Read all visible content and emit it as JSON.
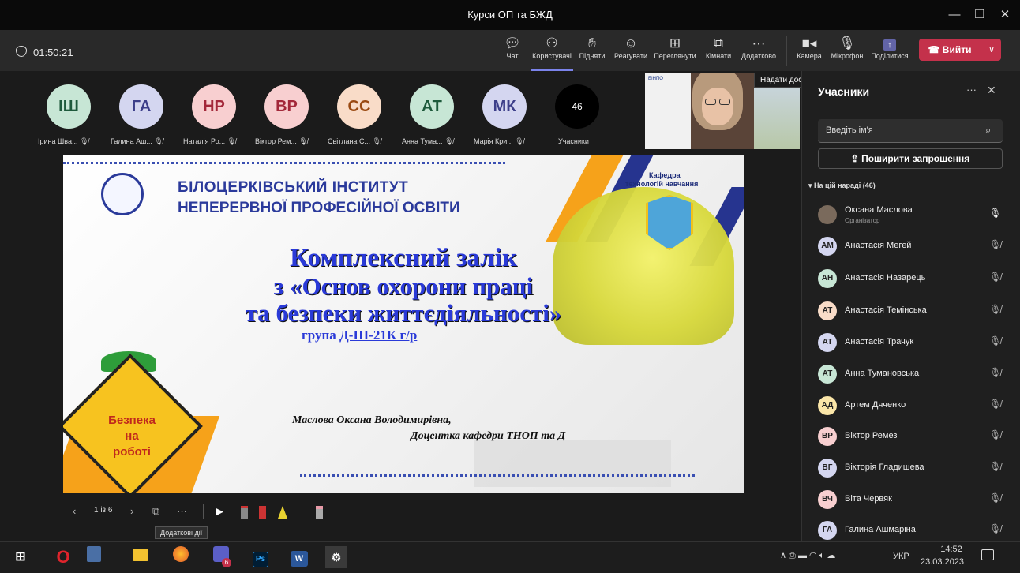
{
  "window": {
    "title": "Курси ОП та БЖД"
  },
  "meeting": {
    "timer": "01:50:21"
  },
  "toolbar": {
    "chat": "Чат",
    "people": "Користувачі",
    "raise": "Підняти",
    "react": "Реагувати",
    "view": "Переглянути",
    "rooms": "Кімнати",
    "more": "Додатково",
    "camera": "Камера",
    "mic": "Мікрофон",
    "share": "Поділитися",
    "leave": "Вийти"
  },
  "share_tooltip": "Надати доступ до вмісту (Ctrl+Shift+E)",
  "gallery": {
    "avatars": [
      {
        "initials": "ІШ",
        "name": "Ірина Шва...",
        "color": "#c7e6d5"
      },
      {
        "initials": "ГА",
        "name": "Галина Аш...",
        "color": "#d4d6f0"
      },
      {
        "initials": "НР",
        "name": "Наталія Ро...",
        "color": "#f8cfd0"
      },
      {
        "initials": "ВР",
        "name": "Віктор Рем...",
        "color": "#f8cfd0"
      },
      {
        "initials": "СС",
        "name": "Світлана С...",
        "color": "#f9dcc8"
      },
      {
        "initials": "АТ",
        "name": "Анна Тума...",
        "color": "#c7e6d5"
      },
      {
        "initials": "МК",
        "name": "Марія Кри...",
        "color": "#d4d6f0"
      }
    ],
    "count": "46",
    "count_label": "Учасники"
  },
  "slide": {
    "institute_line1": "БІЛОЦЕРКІВСЬКИЙ ІНСТИТУТ",
    "institute_line2": "НЕПЕРЕРВНОЇ ПРОФЕСІЙНОЇ ОСВІТИ",
    "dept_line1": "Кафедра",
    "dept_line2": "технологій навчання",
    "heading1": "Комплексний залік",
    "heading2": "з «Основ охорони праці",
    "heading3": "та безпеки життєдіяльності»",
    "group_prefix": "група",
    "group_value": "Д-ІІІ-21К г/р",
    "author": "Маслова Оксана Володимирівна,",
    "position": "Доцентка кафедри ТНОП та Д",
    "sign_line1": "Безпека",
    "sign_line2": "на",
    "sign_line3": "роботі"
  },
  "presenter_tile": {
    "badge": "БІНПО"
  },
  "slidebar": {
    "page": "1 із 6",
    "more_tooltip": "Додаткові дії"
  },
  "panel": {
    "title": "Учасники",
    "search_placeholder": "Введіть ім'я",
    "invite": "Поширити запрошення",
    "section": "На цій нараді (46)",
    "organizer_name": "Оксана Маслова",
    "organizer_role": "Організатор",
    "people": [
      {
        "initials": "АМ",
        "name": "Анастасія Мегей",
        "color": "#d4d6f0"
      },
      {
        "initials": "АН",
        "name": "Анастасія Назарець",
        "color": "#c7e6d5"
      },
      {
        "initials": "АТ",
        "name": "Анастасія Темінська",
        "color": "#f9dcc8"
      },
      {
        "initials": "АТ",
        "name": "Анастасія Трачук",
        "color": "#d4d6f0"
      },
      {
        "initials": "АТ",
        "name": "Анна Тумановська",
        "color": "#c7e6d5"
      },
      {
        "initials": "АД",
        "name": "Артем Дяченко",
        "color": "#fbe6a8"
      },
      {
        "initials": "ВР",
        "name": "Віктор Ремез",
        "color": "#f8cfd0"
      },
      {
        "initials": "ВГ",
        "name": "Вікторія Гладишева",
        "color": "#d4d6f0"
      },
      {
        "initials": "ВЧ",
        "name": "Віта Червяк",
        "color": "#f8cfd0"
      },
      {
        "initials": "ГА",
        "name": "Галина Ашмаріна",
        "color": "#d4d6f0"
      }
    ]
  },
  "taskbar": {
    "lang": "УКР",
    "time": "14:52",
    "date": "23.03.2023",
    "teams_badge": "6"
  }
}
